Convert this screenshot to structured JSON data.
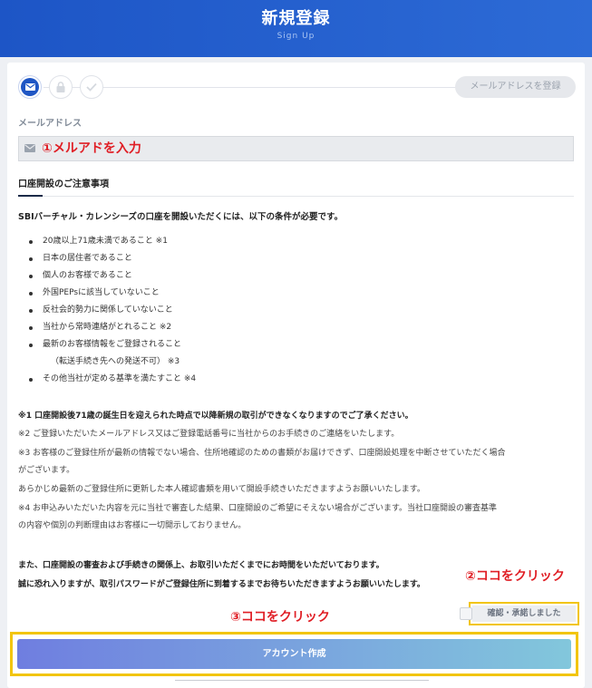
{
  "header": {
    "title": "新規登録",
    "subtitle": "Sign Up"
  },
  "steps": {
    "items": [
      {
        "icon": "envelope-icon",
        "state": "active"
      },
      {
        "icon": "lock-icon",
        "state": "inactive"
      },
      {
        "icon": "check-icon",
        "state": "inactive"
      }
    ],
    "register_email_label": "メールアドレスを登録"
  },
  "email": {
    "label": "メールアドレス",
    "value": "",
    "placeholder": ""
  },
  "annotations": {
    "email_hint": "①メルアドを入力",
    "confirm_hint": "②ココをクリック",
    "create_hint": "③ココをクリック"
  },
  "notice": {
    "title": "口座開設のご注意事項",
    "intro": "SBIバーチャル・カレンシーズの口座を開設いただくには、以下の条件が必要です。",
    "conditions": [
      "20歳以上71歳未満であること ※1",
      "日本の居住者であること",
      "個人のお客様であること",
      "外国PEPsに該当していないこと",
      "反社会的勢力に関係していないこと",
      "当社から常時連絡がとれること ※2",
      "最新のお客様情報をご登録されること",
      "（転送手続き先への発送不可） ※3",
      "その他当社が定める基準を満たすこと ※4"
    ],
    "notes": [
      {
        "text": "※1 口座開設後71歳の誕生日を迎えられた時点で以降新規の取引ができなくなりますのでご了承ください。",
        "bold": true
      },
      {
        "text": "※2 ご登録いただいたメールアドレス又はご登録電話番号に当社からのお手続きのご連絡をいたします。",
        "bold": false
      },
      {
        "text": "※3 お客様のご登録住所が最新の情報でない場合、住所地確認のための書類がお届けできず、口座開設処理を中断させていただく場合",
        "bold": false
      },
      {
        "text": "がございます。",
        "bold": false
      },
      {
        "text": "あらかじめ最新のご登録住所に更新した本人確認書類を用いて開設手続きいただきますようお願いいたします。",
        "bold": false
      },
      {
        "text": "※4 お申込みいただいた内容を元に当社で審査した結果、口座開設のご希望にそえない場合がございます。当社口座開設の審査基準",
        "bold": false
      },
      {
        "text": "の内容や個別の判断理由はお客様に一切開示しておりません。",
        "bold": false
      }
    ],
    "closing": [
      "また、口座開設の審査および手続きの関係上、お取引いただくまでにお時間をいただいております。",
      "誠に恐れ入りますが、取引パスワードがご登録住所に到着するまでお待ちいただきますようお願いいたします。"
    ]
  },
  "confirm": {
    "label": "確認・承諾しました",
    "checked": false
  },
  "create_account": {
    "label": "アカウント作成"
  },
  "colors": {
    "brand": "#1f56c4",
    "highlight": "#f2c50f",
    "annotation": "#e01e25"
  }
}
